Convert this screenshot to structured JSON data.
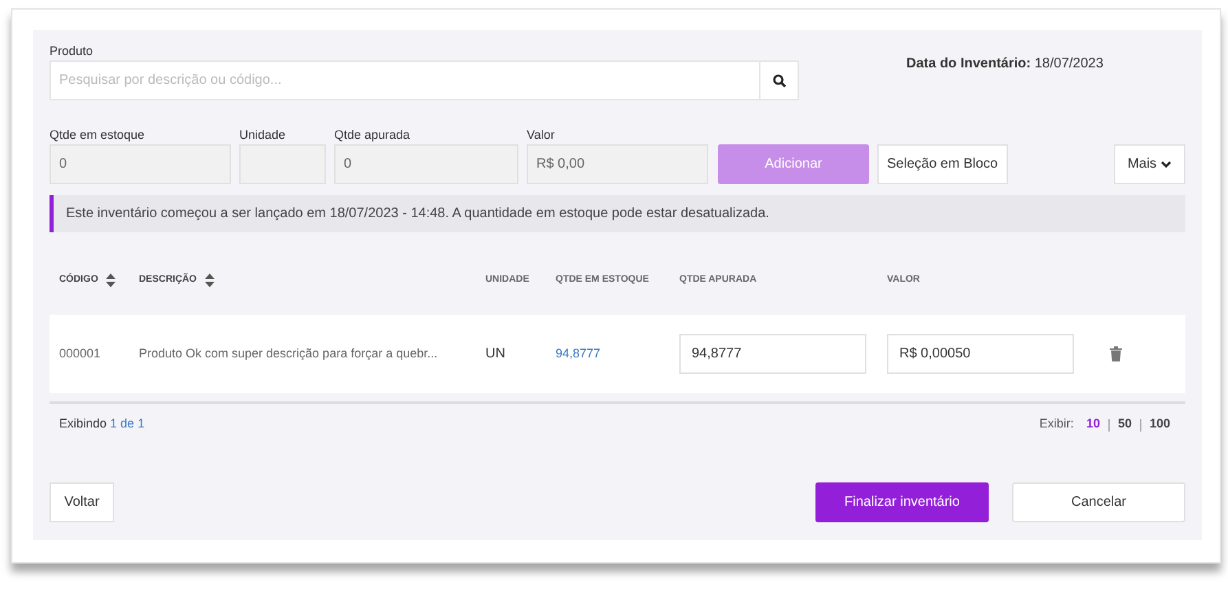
{
  "produto": {
    "label": "Produto",
    "placeholder": "Pesquisar por descrição ou código..."
  },
  "inventory_date": {
    "label": "Data do Inventário:",
    "value": "18/07/2023"
  },
  "fields": [
    {
      "label": "Qtde em estoque",
      "value": "0"
    },
    {
      "label": "Unidade"
    },
    {
      "label": "Qtde apurada",
      "value": "0"
    },
    {
      "label": "Valor",
      "value": "R$ 0,00"
    }
  ],
  "actions": {
    "add": {
      "label": "Adicionar",
      "disabled": true
    },
    "bulk": "Seleção em Bloco",
    "more": "Mais"
  },
  "alert": "Este inventário começou a ser lançado em 18/07/2023 - 14:48. A quantidade em estoque pode estar desatualizada.",
  "table": {
    "columns": [
      {
        "label": "CÓDIGO",
        "sortable": true
      },
      {
        "label": "DESCRIÇÃO",
        "sortable": true
      },
      {
        "label": "UNIDADE",
        "sortable": false
      },
      {
        "label": "QTDE EM ESTOQUE",
        "sortable": false
      },
      {
        "label": "QTDE APURADA",
        "sortable": false
      },
      {
        "label": "VALOR",
        "sortable": false
      }
    ],
    "rows": [
      {
        "codigo": "000001",
        "descricao": "Produto Ok com super descrição para forçar a quebr...",
        "unidade": "UN",
        "qtde_estoque": "94,8777",
        "qtde_apurada": "94,8777",
        "valor": "R$ 0,00050"
      }
    ]
  },
  "footer": {
    "showing_prefix": "Exibindo",
    "showing_range": "1 de 1",
    "page_size_label": "Exibir:",
    "page_sizes": [
      {
        "label": "10",
        "selected": true
      },
      {
        "label": "50",
        "selected": false
      },
      {
        "label": "100",
        "selected": false
      }
    ]
  },
  "buttons": {
    "back": "Voltar",
    "finish": "Finalizar inventário",
    "cancel": "Cancelar"
  }
}
